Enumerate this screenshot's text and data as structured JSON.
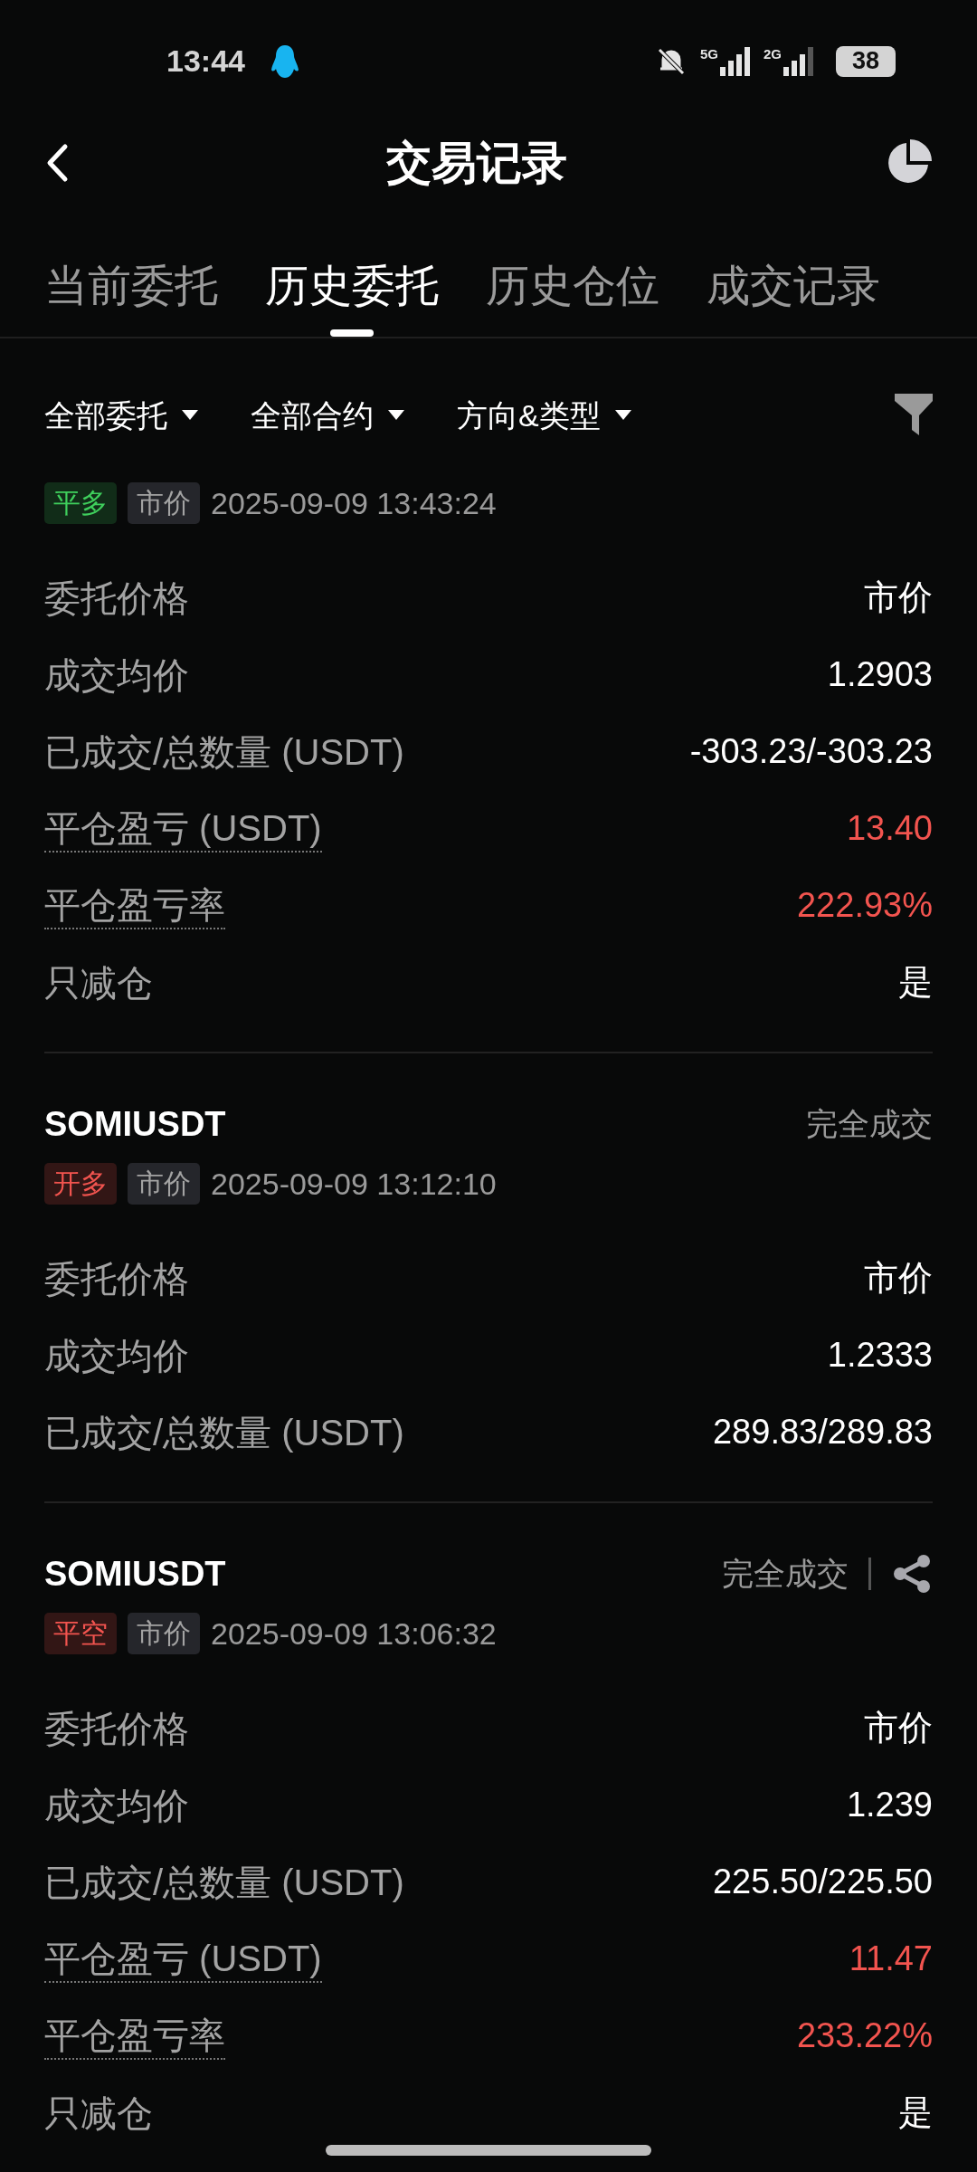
{
  "status_bar": {
    "time": "13:44",
    "network_1": "5G",
    "network_2": "2G",
    "battery": "38"
  },
  "header": {
    "title": "交易记录"
  },
  "tabs": [
    {
      "label": "当前委托",
      "selected": false
    },
    {
      "label": "历史委托",
      "selected": true
    },
    {
      "label": "历史仓位",
      "selected": false
    },
    {
      "label": "成交记录",
      "selected": false
    }
  ],
  "filters": [
    {
      "label": "全部委托"
    },
    {
      "label": "全部合约"
    },
    {
      "label": "方向&类型"
    }
  ],
  "orders": [
    {
      "side": {
        "text": "平多",
        "color": "#3fcf5c"
      },
      "type": "市价",
      "time": "2025-09-09 13:43:24",
      "share": false,
      "rows": [
        {
          "kind": "plain",
          "label": "委托价格",
          "value": "市价"
        },
        {
          "kind": "plain",
          "label": "成交均价",
          "value": "1.2903"
        },
        {
          "kind": "plain",
          "label": "已成交/总数量 (USDT)",
          "value": "-303.23/-303.23"
        },
        {
          "kind": "pnl",
          "label": "平仓盈亏 (USDT)",
          "value": "13.40"
        },
        {
          "kind": "pnl",
          "label": "平仓盈亏率",
          "value": "222.93%"
        },
        {
          "kind": "plain",
          "label": "只减仓",
          "value": "是"
        }
      ]
    },
    {
      "symbol": "SOMIUSDT",
      "status": "完全成交",
      "side": {
        "text": "开多",
        "color": "#f2544f"
      },
      "type": "市价",
      "time": "2025-09-09 13:12:10",
      "share": false,
      "rows": [
        {
          "kind": "plain",
          "label": "委托价格",
          "value": "市价"
        },
        {
          "kind": "plain",
          "label": "成交均价",
          "value": "1.2333"
        },
        {
          "kind": "plain",
          "label": "已成交/总数量 (USDT)",
          "value": "289.83/289.83"
        }
      ]
    },
    {
      "symbol": "SOMIUSDT",
      "status": "完全成交",
      "side": {
        "text": "平空",
        "color": "#f2544f"
      },
      "type": "市价",
      "time": "2025-09-09 13:06:32",
      "share": true,
      "rows": [
        {
          "kind": "plain",
          "label": "委托价格",
          "value": "市价"
        },
        {
          "kind": "plain",
          "label": "成交均价",
          "value": "1.239"
        },
        {
          "kind": "plain",
          "label": "已成交/总数量 (USDT)",
          "value": "225.50/225.50"
        },
        {
          "kind": "pnl",
          "label": "平仓盈亏 (USDT)",
          "value": "11.47"
        },
        {
          "kind": "pnl",
          "label": "平仓盈亏率",
          "value": "233.22%"
        },
        {
          "kind": "plain",
          "label": "只减仓",
          "value": "是"
        }
      ]
    }
  ]
}
